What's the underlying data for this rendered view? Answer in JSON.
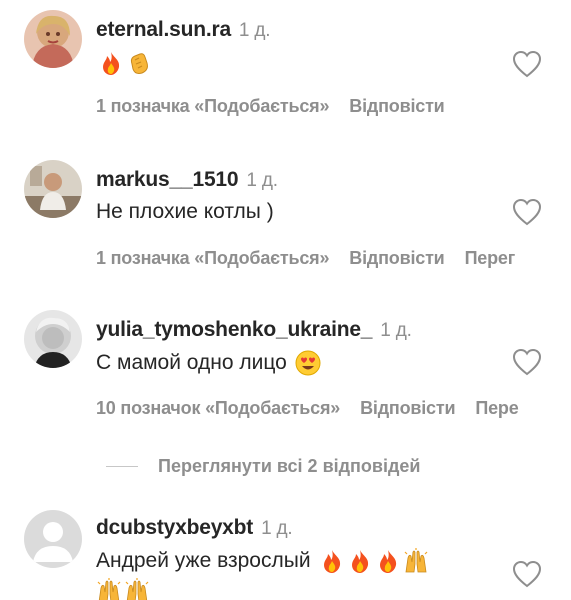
{
  "comments": [
    {
      "username": "eternal.sun.ra",
      "time": "1 д.",
      "text": "",
      "emojis": [
        "fire-emoji",
        "clapping-hands-emoji"
      ],
      "likes": "1 позначка «Подобається»",
      "reply": "Відповісти",
      "translate": ""
    },
    {
      "username": "markus__1510",
      "time": "1 д.",
      "text": "Не плохие котлы )",
      "emojis": [],
      "likes": "1 позначка «Подобається»",
      "reply": "Відповісти",
      "translate": "Перег"
    },
    {
      "username": "yulia_tymoshenko_ukraine_",
      "time": "1 д.",
      "text": "С мамой одно лицо",
      "emojis": [
        "heart-eyes-emoji"
      ],
      "likes": "10 позначок «Подобається»",
      "reply": "Відповісти",
      "translate": "Пере"
    },
    {
      "username": "dcubstyxbeyxbt",
      "time": "1 д.",
      "text": "Андрей уже взрослый",
      "emojis": [
        "fire-emoji",
        "fire-emoji",
        "fire-emoji",
        "raising-hands-emoji",
        "raising-hands-emoji",
        "raising-hands-emoji"
      ],
      "likes": "",
      "reply": "",
      "translate": ""
    }
  ],
  "view_replies": "Переглянути всі 2 відповідей",
  "colors": {
    "text": "#262626",
    "secondary": "#8e8e8e",
    "divider": "#c7c7c7",
    "fire": "#f4511e",
    "skin": "#f7b538"
  }
}
